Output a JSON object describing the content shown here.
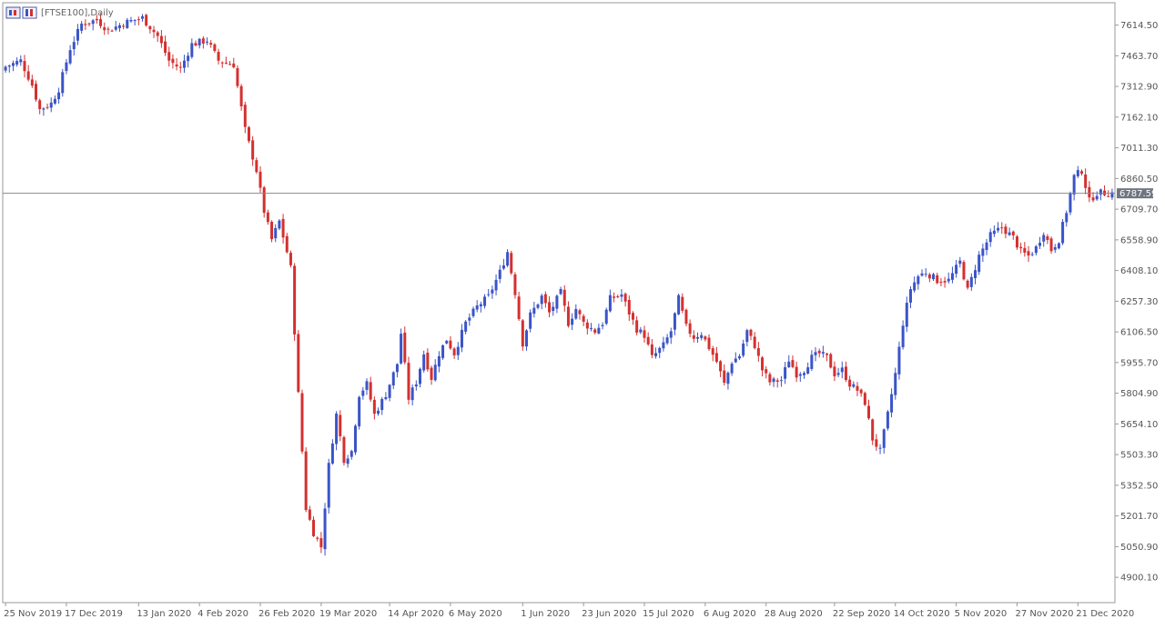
{
  "chart_data": {
    "type": "candlestick",
    "title": "[FTSE100],Daily",
    "xlabel": "",
    "ylabel": "",
    "ylim": [
      4780,
      7720
    ],
    "grid": false,
    "current_price": 6787.59,
    "current_price_label": "6787.59",
    "colors": {
      "up": "#3a54c7",
      "down": "#d43030",
      "price_line": "#888888",
      "axis": "#999999"
    },
    "y_tick_labels": [
      "7614.50",
      "7463.70",
      "7312.90",
      "7162.10",
      "7011.30",
      "6860.50",
      "6709.70",
      "6558.90",
      "6408.10",
      "6257.30",
      "6106.50",
      "5955.70",
      "5804.90",
      "5654.10",
      "5503.30",
      "5352.50",
      "5201.70",
      "5050.90",
      "4900.10"
    ],
    "x_tick_labels": [
      "25 Nov 2019",
      "17 Dec 2019",
      "13 Jan 2020",
      "4 Feb 2020",
      "26 Feb 2020",
      "19 Mar 2020",
      "14 Apr 2020",
      "6 May 2020",
      "1 Jun 2020",
      "23 Jun 2020",
      "15 Jul 2020",
      "6 Aug 2020",
      "28 Aug 2020",
      "22 Sep 2020",
      "14 Oct 2020",
      "5 Nov 2020",
      "27 Nov 2020",
      "21 Dec 2020"
    ],
    "x_tick_index": [
      0,
      16,
      35,
      51,
      67,
      83,
      101,
      117,
      136,
      152,
      168,
      184,
      200,
      218,
      234,
      250,
      266,
      282
    ],
    "close_path": [
      [
        0,
        7410
      ],
      [
        4,
        7440
      ],
      [
        7,
        7320
      ],
      [
        9,
        7200
      ],
      [
        12,
        7230
      ],
      [
        14,
        7300
      ],
      [
        17,
        7500
      ],
      [
        20,
        7620
      ],
      [
        24,
        7640
      ],
      [
        27,
        7590
      ],
      [
        32,
        7630
      ],
      [
        36,
        7650
      ],
      [
        40,
        7560
      ],
      [
        43,
        7440
      ],
      [
        46,
        7400
      ],
      [
        49,
        7520
      ],
      [
        53,
        7540
      ],
      [
        56,
        7440
      ],
      [
        60,
        7420
      ],
      [
        63,
        7100
      ],
      [
        66,
        6900
      ],
      [
        68,
        6700
      ],
      [
        70,
        6560
      ],
      [
        72,
        6650
      ],
      [
        74,
        6500
      ],
      [
        75,
        6420
      ],
      [
        77,
        5800
      ],
      [
        79,
        5240
      ],
      [
        81,
        5120
      ],
      [
        83,
        5050
      ],
      [
        85,
        5450
      ],
      [
        87,
        5700
      ],
      [
        89,
        5480
      ],
      [
        91,
        5520
      ],
      [
        93,
        5800
      ],
      [
        95,
        5850
      ],
      [
        97,
        5700
      ],
      [
        100,
        5800
      ],
      [
        103,
        5950
      ],
      [
        104,
        6100
      ],
      [
        106,
        5780
      ],
      [
        108,
        5860
      ],
      [
        110,
        6000
      ],
      [
        112,
        5880
      ],
      [
        114,
        6000
      ],
      [
        116,
        6070
      ],
      [
        118,
        6000
      ],
      [
        121,
        6150
      ],
      [
        124,
        6230
      ],
      [
        127,
        6280
      ],
      [
        130,
        6400
      ],
      [
        132,
        6500
      ],
      [
        134,
        6300
      ],
      [
        136,
        6050
      ],
      [
        138,
        6190
      ],
      [
        141,
        6280
      ],
      [
        143,
        6200
      ],
      [
        146,
        6300
      ],
      [
        148,
        6150
      ],
      [
        150,
        6220
      ],
      [
        152,
        6150
      ],
      [
        155,
        6110
      ],
      [
        157,
        6150
      ],
      [
        159,
        6270
      ],
      [
        162,
        6290
      ],
      [
        164,
        6200
      ],
      [
        166,
        6120
      ],
      [
        168,
        6090
      ],
      [
        170,
        5980
      ],
      [
        173,
        6040
      ],
      [
        175,
        6110
      ],
      [
        177,
        6270
      ],
      [
        179,
        6130
      ],
      [
        181,
        6080
      ],
      [
        183,
        6100
      ],
      [
        185,
        6030
      ],
      [
        187,
        5960
      ],
      [
        189,
        5850
      ],
      [
        191,
        5960
      ],
      [
        193,
        5990
      ],
      [
        195,
        6110
      ],
      [
        197,
        6040
      ],
      [
        199,
        5920
      ],
      [
        201,
        5860
      ],
      [
        204,
        5870
      ],
      [
        206,
        5970
      ],
      [
        208,
        5900
      ],
      [
        210,
        5920
      ],
      [
        212,
        5980
      ],
      [
        214,
        6000
      ],
      [
        216,
        5980
      ],
      [
        218,
        5900
      ],
      [
        220,
        5920
      ],
      [
        222,
        5850
      ],
      [
        224,
        5820
      ],
      [
        226,
        5760
      ],
      [
        228,
        5580
      ],
      [
        230,
        5520
      ],
      [
        232,
        5700
      ],
      [
        234,
        5900
      ],
      [
        236,
        6150
      ],
      [
        238,
        6320
      ],
      [
        240,
        6380
      ],
      [
        242,
        6400
      ],
      [
        245,
        6360
      ],
      [
        248,
        6360
      ],
      [
        251,
        6450
      ],
      [
        253,
        6310
      ],
      [
        256,
        6480
      ],
      [
        259,
        6580
      ],
      [
        262,
        6620
      ],
      [
        265,
        6570
      ],
      [
        267,
        6500
      ],
      [
        269,
        6480
      ],
      [
        271,
        6520
      ],
      [
        273,
        6600
      ],
      [
        275,
        6510
      ],
      [
        277,
        6560
      ],
      [
        279,
        6700
      ],
      [
        281,
        6870
      ],
      [
        283,
        6900
      ],
      [
        285,
        6750
      ],
      [
        287,
        6790
      ]
    ]
  }
}
